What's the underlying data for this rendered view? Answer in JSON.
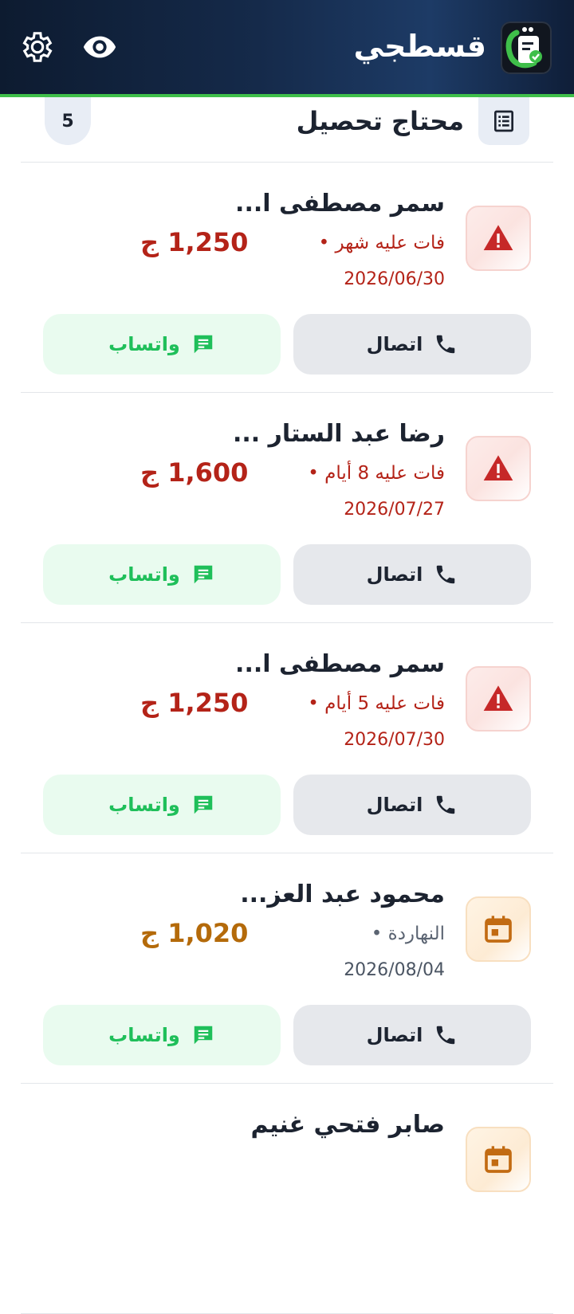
{
  "app": {
    "title": "قسطجي"
  },
  "section": {
    "title": "محتاج تحصيل",
    "count": "5"
  },
  "labels": {
    "call": "اتصال",
    "whatsapp": "واتساب"
  },
  "colors": {
    "overdue": "#b42318",
    "upcoming": "#b46a0a",
    "whatsapp": "#1fbf5a",
    "accent_green": "#3fbf4a"
  },
  "cards": [
    {
      "name": "سمر مصطفى ا...",
      "status": "فات عليه شهر •",
      "date": "2026/06/30",
      "amount": "1,250 ج",
      "kind": "overdue",
      "icon": "warning-icon"
    },
    {
      "name": "رضا عبد الستار ...",
      "status": "فات عليه 8 أيام •",
      "date": "2026/07/27",
      "amount": "1,600 ج",
      "kind": "overdue",
      "icon": "warning-icon"
    },
    {
      "name": "سمر مصطفى ا...",
      "status": "فات عليه 5 أيام •",
      "date": "2026/07/30",
      "amount": "1,250 ج",
      "kind": "overdue",
      "icon": "warning-icon"
    },
    {
      "name": "محمود عبد العز...",
      "status": "النهاردة •",
      "date": "2026/08/04",
      "amount": "1,020 ج",
      "kind": "upcoming",
      "icon": "calendar-icon"
    },
    {
      "name": "صابر فتحي غنيم",
      "status": "",
      "date": "",
      "amount": "",
      "kind": "upcoming",
      "icon": "calendar-icon"
    }
  ]
}
